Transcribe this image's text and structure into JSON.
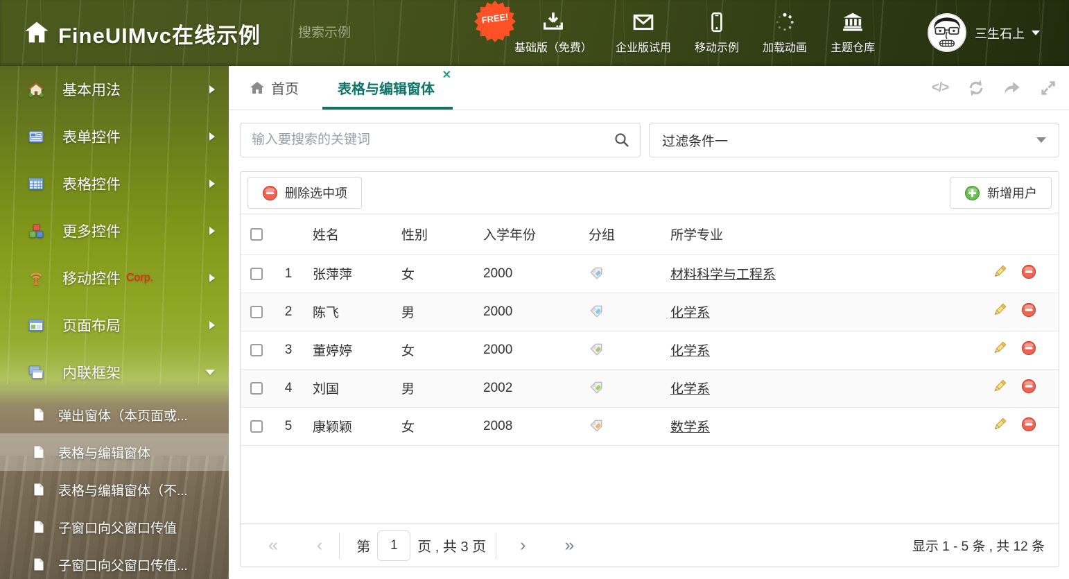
{
  "header": {
    "title": "FineUIMvc在线示例",
    "search_placeholder": "搜索示例",
    "free_badge": "FREE!",
    "nav_items": [
      {
        "label": "基础版（免费）",
        "icon": "download-icon"
      },
      {
        "label": "企业版试用",
        "icon": "envelope-icon"
      },
      {
        "label": "移动示例",
        "icon": "mobile-icon"
      },
      {
        "label": "加载动画",
        "icon": "spinner-icon"
      },
      {
        "label": "主题仓库",
        "icon": "bank-icon"
      }
    ],
    "username": "三生石上"
  },
  "sidebar": {
    "items": [
      {
        "label": "基本用法",
        "icon": "home-icon",
        "arrow": "right"
      },
      {
        "label": "表单控件",
        "icon": "form-icon",
        "arrow": "right"
      },
      {
        "label": "表格控件",
        "icon": "table-icon",
        "arrow": "right"
      },
      {
        "label": "更多控件",
        "icon": "cubes-icon",
        "arrow": "right"
      },
      {
        "label": "移动控件",
        "badge": "Corp.",
        "icon": "antenna-icon",
        "arrow": "right"
      },
      {
        "label": "页面布局",
        "icon": "layout-icon",
        "arrow": "right"
      },
      {
        "label": "内联框架",
        "icon": "frames-icon",
        "arrow": "down"
      }
    ],
    "subitems": [
      {
        "label": "弹出窗体（本页面或...",
        "icon": "document-icon",
        "selected": false
      },
      {
        "label": "表格与编辑窗体",
        "icon": "document-icon",
        "selected": true
      },
      {
        "label": "表格与编辑窗体（不...",
        "icon": "document-icon",
        "selected": false
      },
      {
        "label": "子窗口向父窗口传值",
        "icon": "document-icon",
        "selected": false
      },
      {
        "label": "子窗口向父窗口传值...",
        "icon": "document-icon",
        "selected": false
      }
    ]
  },
  "tabbar": {
    "home_tab": "首页",
    "active_tab": "表格与编辑窗体",
    "close_glyph": "✕"
  },
  "filters": {
    "search_placeholder": "输入要搜索的关键词",
    "filter_selected": "过滤条件一"
  },
  "toolbar": {
    "delete_label": "删除选中项",
    "add_label": "新增用户"
  },
  "table": {
    "headers": {
      "name": "姓名",
      "gender": "性别",
      "year": "入学年份",
      "group": "分组",
      "major": "所学专业"
    },
    "rows": [
      {
        "num": "1",
        "name": "张萍萍",
        "gender": "女",
        "year": "2000",
        "tag_color": "#85c8f2",
        "major": "材料科学与工程系"
      },
      {
        "num": "2",
        "name": "陈飞",
        "gender": "男",
        "year": "2000",
        "tag_color": "#85c8f2",
        "major": "化学系"
      },
      {
        "num": "3",
        "name": "董婷婷",
        "gender": "女",
        "year": "2000",
        "tag_color": "#9ccf6e",
        "major": "化学系"
      },
      {
        "num": "4",
        "name": "刘国",
        "gender": "男",
        "year": "2002",
        "tag_color": "#9ccf6e",
        "major": "化学系"
      },
      {
        "num": "5",
        "name": "康颖颖",
        "gender": "女",
        "year": "2008",
        "tag_color": "#f6b26b",
        "major": "数学系"
      }
    ]
  },
  "pagination": {
    "page_prefix": "第",
    "page_value": "1",
    "page_suffix": "页 , 共 3 页",
    "summary": "显示 1 - 5 条 , 共 12 条"
  },
  "colors": {
    "accent_teal": "#11705f",
    "badge_orange": "#ff5126",
    "tag_blue": "#85c8f2",
    "tag_green": "#9ccf6e",
    "tag_orange": "#f6b26b"
  }
}
